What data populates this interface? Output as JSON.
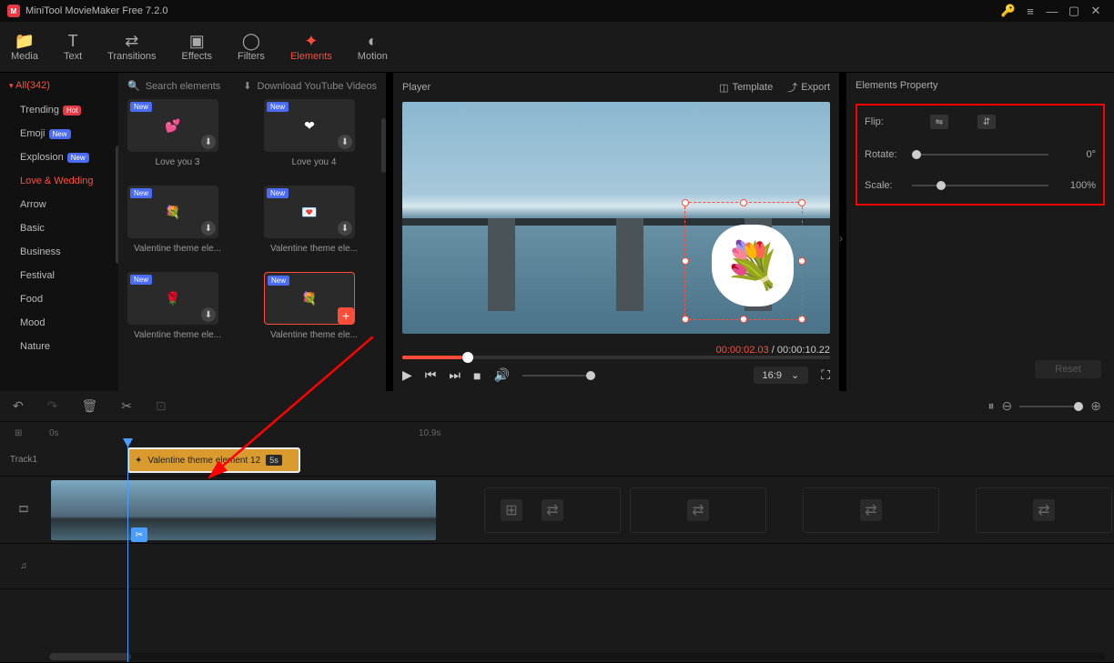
{
  "app": {
    "title": "MiniTool MovieMaker Free 7.2.0"
  },
  "tabs": {
    "media": "Media",
    "text": "Text",
    "transitions": "Transitions",
    "effects": "Effects",
    "filters": "Filters",
    "elements": "Elements",
    "motion": "Motion"
  },
  "sidebar": {
    "all": "All(342)",
    "cats": [
      {
        "label": "Trending",
        "badge": "Hot",
        "cls": "hot"
      },
      {
        "label": "Emoji",
        "badge": "New",
        "cls": "new"
      },
      {
        "label": "Explosion",
        "badge": "New",
        "cls": "new"
      },
      {
        "label": "Love & Wedding",
        "active": true
      },
      {
        "label": "Arrow"
      },
      {
        "label": "Basic"
      },
      {
        "label": "Business"
      },
      {
        "label": "Festival"
      },
      {
        "label": "Food"
      },
      {
        "label": "Mood"
      },
      {
        "label": "Nature"
      }
    ]
  },
  "elemhead": {
    "search": "Search elements",
    "download": "Download YouTube Videos"
  },
  "elements": [
    {
      "label": "Love you 3",
      "glyph": "💕"
    },
    {
      "label": "Love you 4",
      "glyph": "❤"
    },
    {
      "label": "Valentine theme ele...",
      "glyph": "💐"
    },
    {
      "label": "Valentine theme ele...",
      "glyph": "💌"
    },
    {
      "label": "Valentine theme ele...",
      "glyph": "🌹"
    },
    {
      "label": "Valentine theme ele...",
      "glyph": "💐",
      "sel": true
    }
  ],
  "player": {
    "title": "Player",
    "template": "Template",
    "export": "Export",
    "current": "00:00:02.03",
    "sep": " / ",
    "total": "00:00:10.22",
    "aspect": "16:9"
  },
  "props": {
    "title": "Elements Property",
    "flip": "Flip:",
    "rotate": {
      "label": "Rotate:",
      "value": "0°"
    },
    "scale": {
      "label": "Scale:",
      "value": "100%"
    },
    "reset": "Reset"
  },
  "timeline": {
    "start": "0s",
    "mid": "10.9s",
    "track1": "Track1",
    "clip": {
      "name": "Valentine theme element 12",
      "dur": "5s"
    }
  }
}
